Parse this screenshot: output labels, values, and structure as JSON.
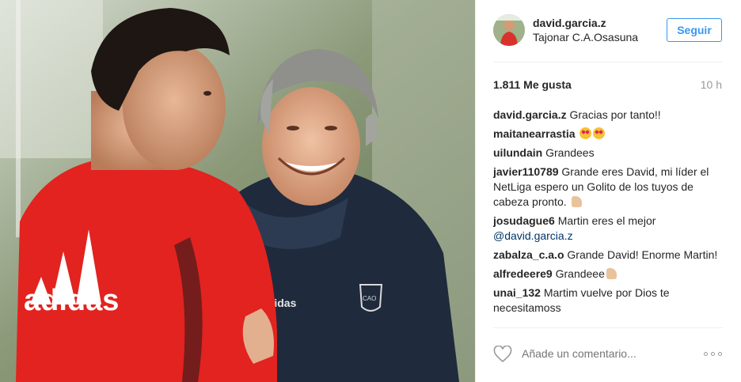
{
  "post": {
    "username": "david.garcia.z",
    "location": "Tajonar C.A.Osasuna",
    "follow_label": "Seguir",
    "likes": "1.811 Me gusta",
    "time": "10 h",
    "photo": {
      "left_shirt_brand": "adidas",
      "right_jacket_brand": "adidas",
      "crest_text": "CAO"
    }
  },
  "comments": [
    {
      "user": "david.garcia.z",
      "text": "Gracias por tanto!!"
    },
    {
      "user": "maitanearrastia",
      "text": "",
      "emoji": "heart-eyes-x2"
    },
    {
      "user": "uilundain",
      "text": "Grandees"
    },
    {
      "user": "javier110789",
      "text": "Grande eres David, mi líder el NetLiga espero un Golito de los tuyos de cabeza pronto.",
      "emoji": "flexed-biceps"
    },
    {
      "user": "josudague6",
      "text": "Martin eres el mejor",
      "mention": "@david.garcia.z"
    },
    {
      "user": "zabalza_c.a.o",
      "text": "Grande David! Enorme Martin!"
    },
    {
      "user": "alfredeere9",
      "text": "Grandeee",
      "emoji": "flexed-biceps"
    },
    {
      "user": "unai_132",
      "text": "Martim vuelve por Dios te necesitamoss"
    }
  ],
  "footer": {
    "comment_placeholder": "Añade un comentario...",
    "like_icon": "heart-outline-icon",
    "more_icon": "more-options-icon"
  }
}
